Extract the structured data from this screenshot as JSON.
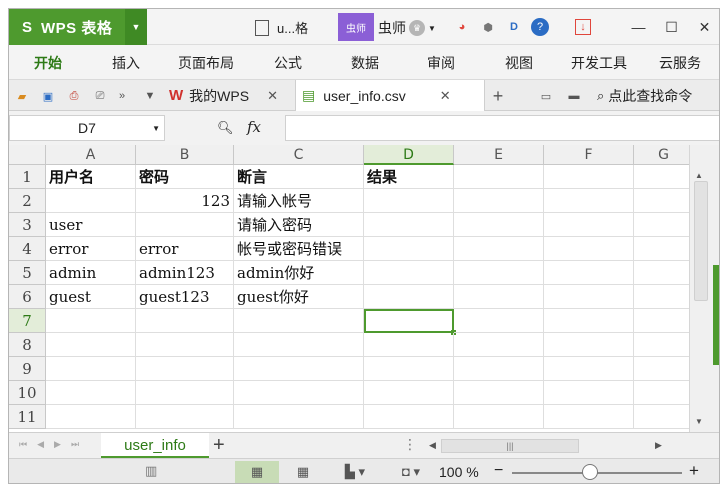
{
  "app": {
    "logo_glyph": "S",
    "name": "WPS 表格",
    "doc_title": "u...格",
    "user_badge": "虫师",
    "user_name": "虫师"
  },
  "menu": [
    "开始",
    "插入",
    "页面布局",
    "公式",
    "数据",
    "审阅",
    "视图",
    "开发工具",
    "云服务"
  ],
  "tabs": {
    "mywps": "我的WPS",
    "file": "user_info.csv",
    "search_cmd": "点此查找命令"
  },
  "formula": {
    "cell_ref": "D7",
    "fx": "fx",
    "value": ""
  },
  "grid": {
    "columns": [
      "A",
      "B",
      "C",
      "D",
      "E",
      "F",
      "G"
    ],
    "rows": [
      "1",
      "2",
      "3",
      "4",
      "5",
      "6",
      "7",
      "8",
      "9",
      "10",
      "11"
    ],
    "cells": [
      [
        "用户名",
        "密码",
        "断言",
        "结果"
      ],
      [
        "",
        "123",
        "请输入帐号",
        ""
      ],
      [
        "user",
        "",
        "请输入密码",
        ""
      ],
      [
        "error",
        "error",
        "帐号或密码错误",
        ""
      ],
      [
        "admin",
        "admin123",
        "admin你好",
        ""
      ],
      [
        "guest",
        "guest123",
        "guest你好",
        ""
      ]
    ],
    "active_cell": "D7"
  },
  "sheets": {
    "active": "user_info",
    "add": "+"
  },
  "status": {
    "zoom": "100 %",
    "zoom_level": 0.46
  },
  "colors": {
    "accent": "#4e9a2e",
    "user_badge": "#8b5fd6"
  }
}
